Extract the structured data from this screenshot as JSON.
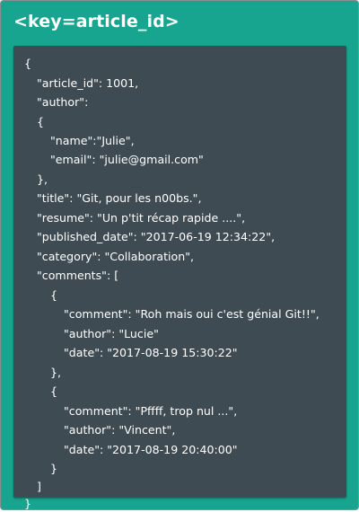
{
  "card": {
    "title": "<key=article_id>"
  },
  "code": {
    "lines": [
      "{",
      "\"article_id\": 1001,",
      "\"author\":",
      "{",
      "\"name\":\"Julie\",",
      "\"email\": \"julie@gmail.com\"",
      "},",
      "\"title\": \"Git, pour les n00bs.\",",
      "\"resume\": \"Un p'tit récap rapide ....\",",
      "\"published_date\": \"2017-06-19 12:34:22\",",
      "\"category\": \"Collaboration\",",
      "\"comments\": [",
      "{",
      "\"comment\": \"Roh mais oui c'est génial Git!!\",",
      "\"author\": \"Lucie\"",
      "\"date\": \"2017-08-19 15:30:22\"",
      "},",
      "{",
      "\"comment\": \"Pffff, trop nul ...\",",
      "\"author\": \"Vincent\",",
      "\"date\": \"2017-08-19 20:40:00\"",
      "}",
      "]",
      "}"
    ]
  },
  "colors": {
    "card_background": "#17a58f",
    "code_background": "#3f4b53",
    "text": "#ffffff"
  }
}
